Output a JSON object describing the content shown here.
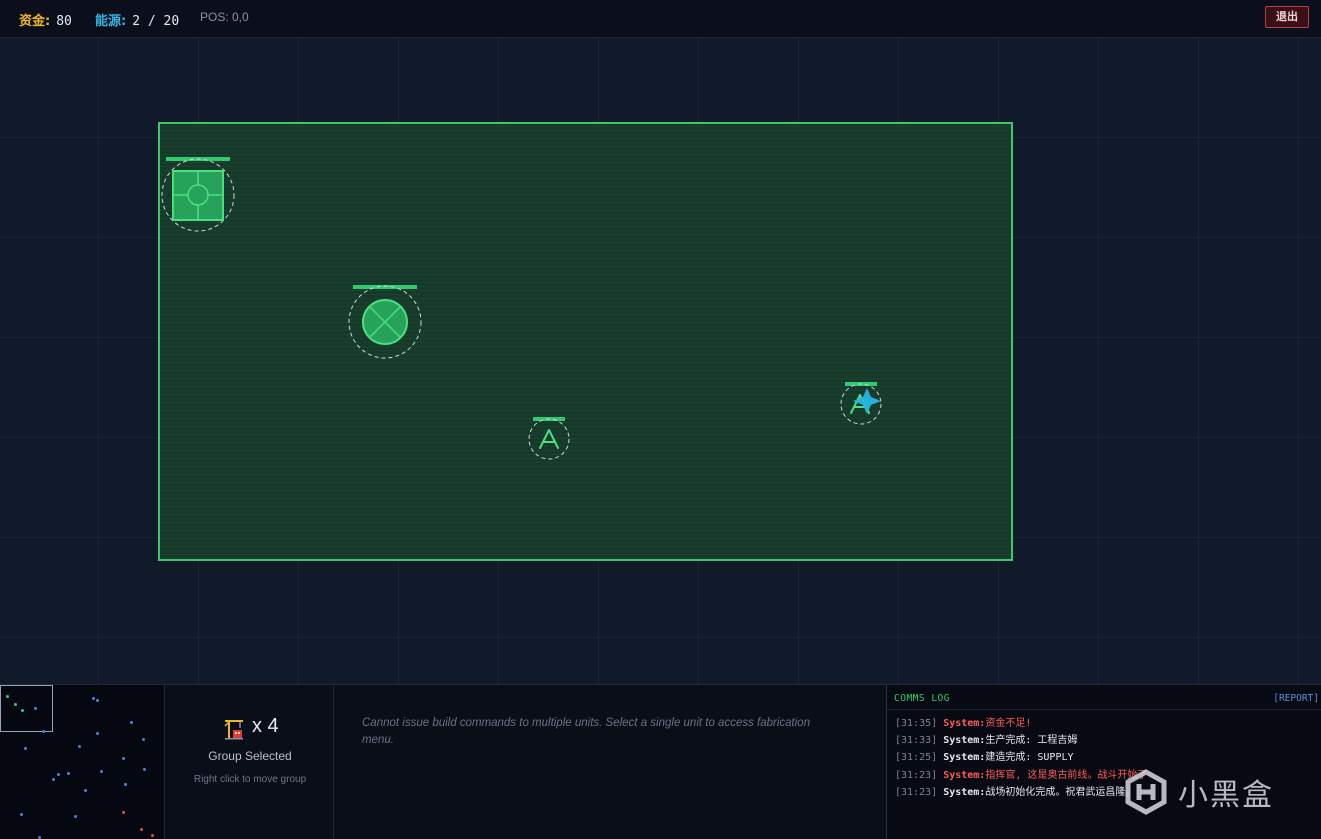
{
  "resources": {
    "funds_label": "资金:",
    "funds_value": "80",
    "energy_label": "能源:",
    "energy_value": "2 / 20",
    "pos": "POS: 0,0"
  },
  "topbar": {
    "exit_label": "退出"
  },
  "colors": {
    "funds": "#f0b429",
    "energy": "#33b5e5",
    "selection_border": "#3ec86a",
    "unit": "#2ecc71",
    "enemy_marker": "#29b6e6",
    "error": "#ff5d5d"
  },
  "units": [
    {
      "type": "command-center",
      "icon": "building-icon"
    },
    {
      "type": "generator",
      "icon": "crossed-circle-icon"
    },
    {
      "type": "engineer",
      "icon": "triangle-icon"
    },
    {
      "type": "engineer",
      "icon": "triangle-icon",
      "targeted": true
    }
  ],
  "selection": {
    "icon": "crane-icon",
    "count": "x 4",
    "title": "Group Selected",
    "hint": "Right click to move group"
  },
  "build_panel": {
    "message": "Cannot issue build commands to multiple units. Select a single unit to access fabrication menu."
  },
  "comms": {
    "title": "COMMS LOG",
    "report_label": "[REPORT]",
    "entries": [
      {
        "time": "[31:35]",
        "sender": "System:",
        "text": "资金不足!",
        "level": "error"
      },
      {
        "time": "[31:33]",
        "sender": "System:",
        "text": "生产完成: 工程吉姆",
        "level": "info"
      },
      {
        "time": "[31:25]",
        "sender": "System:",
        "text": "建造完成: SUPPLY",
        "level": "info"
      },
      {
        "time": "[31:23]",
        "sender": "System:",
        "text": "指挥官, 这是奥古前线。战斗开始了",
        "level": "error"
      },
      {
        "time": "[31:23]",
        "sender": "System:",
        "text": "战场初始化完成。祝君武运昌隆。",
        "level": "info"
      }
    ]
  },
  "watermark": {
    "text": "小黑盒"
  }
}
